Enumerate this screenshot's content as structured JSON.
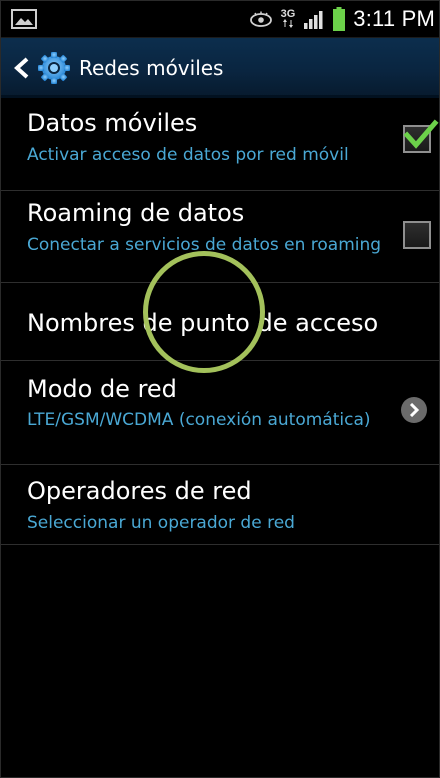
{
  "status_bar": {
    "time": "3:11 PM",
    "network_type": "3G",
    "icons": [
      "picture-icon",
      "eye-icon",
      "data-arrows-icon",
      "signal-icon",
      "battery-icon"
    ]
  },
  "action_bar": {
    "title": "Redes móviles",
    "back_icon": "chevron-left-icon",
    "app_icon": "gear-icon"
  },
  "settings": [
    {
      "title": "Datos móviles",
      "subtitle": "Activar acceso de datos por red móvil",
      "control": "checkbox",
      "checked": true
    },
    {
      "title": "Roaming de datos",
      "subtitle": "Conectar a servicios de datos en roaming",
      "control": "checkbox",
      "checked": false
    },
    {
      "title": "Nombres de punto de acceso",
      "subtitle": "",
      "control": "none"
    },
    {
      "title": "Modo de red",
      "subtitle": "LTE/GSM/WCDMA (conexión automática)",
      "control": "chevron-right-icon"
    },
    {
      "title": "Operadores de red",
      "subtitle": "Seleccionar un operador de red",
      "control": "none"
    }
  ],
  "colors": {
    "action_bar": "#0a2540",
    "subtitle": "#4aa8d4",
    "checkmark": "#6cd14a",
    "touch_indicator": "#a3c15b",
    "battery": "#6cd14a"
  }
}
